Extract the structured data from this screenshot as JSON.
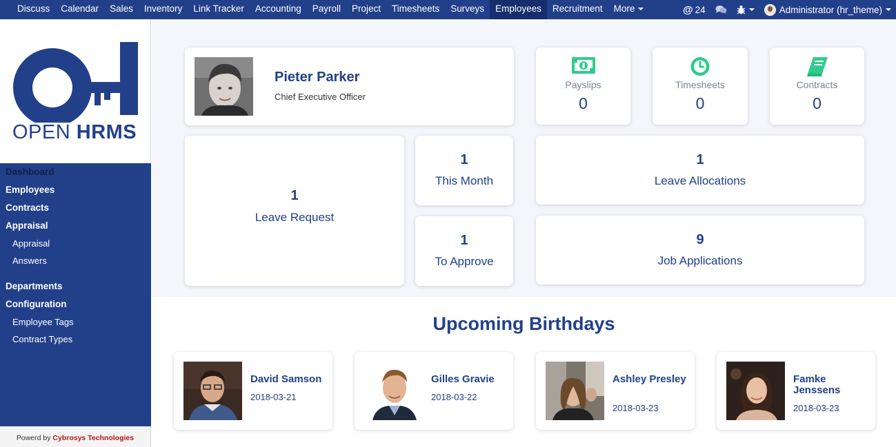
{
  "topbar": {
    "menu": [
      "Discuss",
      "Calendar",
      "Sales",
      "Inventory",
      "Link Tracker",
      "Accounting",
      "Payroll",
      "Project",
      "Timesheets",
      "Surveys",
      "Employees",
      "Recruitment"
    ],
    "more_label": "More",
    "active_menu": "Employees",
    "mentions_count": "24",
    "user_label": "Administrator (hr_theme)"
  },
  "sidebar": {
    "logo": {
      "part1": "OPEN ",
      "part2": "HRMS"
    },
    "sections": [
      {
        "label": "Dashboard",
        "current": true,
        "children": []
      },
      {
        "label": "Employees",
        "children": []
      },
      {
        "label": "Contracts",
        "children": []
      },
      {
        "label": "Appraisal",
        "children": [
          "Appraisal",
          "Answers"
        ]
      },
      {
        "label": "Departments",
        "children": []
      },
      {
        "label": "Configuration",
        "children": [
          "Employee Tags",
          "Contract Types"
        ]
      }
    ],
    "powered_prefix": "Powerd by ",
    "powered_brand": "Cybrosys Technologies"
  },
  "profile": {
    "name": "Pieter Parker",
    "job_title": "Chief Executive Officer"
  },
  "stats": [
    {
      "label": "Payslips",
      "value": "0",
      "icon": "money-icon"
    },
    {
      "label": "Timesheets",
      "value": "0",
      "icon": "clock-icon"
    },
    {
      "label": "Contracts",
      "value": "0",
      "icon": "book-icon"
    }
  ],
  "kpis": {
    "leave_request": {
      "count": "1",
      "label": "Leave Request"
    },
    "this_month": {
      "count": "1",
      "label": "This Month"
    },
    "to_approve": {
      "count": "1",
      "label": "To Approve"
    },
    "leave_allocations": {
      "count": "1",
      "label": "Leave Allocations"
    },
    "job_applications": {
      "count": "9",
      "label": "Job Applications"
    }
  },
  "birthdays": {
    "title": "Upcoming Birthdays",
    "people": [
      {
        "name": "David Samson",
        "date": "2018-03-21"
      },
      {
        "name": "Gilles Gravie",
        "date": "2018-03-22"
      },
      {
        "name": "Ashley Presley",
        "date": "2018-03-23"
      },
      {
        "name": "Famke Jenssens",
        "date": "2018-03-23"
      }
    ]
  },
  "colors": {
    "brand_blue": "#22408a",
    "accent_green": "#2ecc8b",
    "page_bg": "#f5f6fb"
  }
}
